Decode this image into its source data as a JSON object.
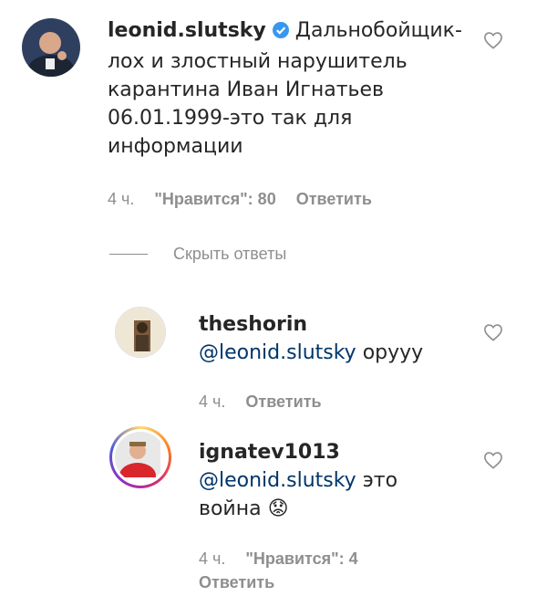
{
  "comments": [
    {
      "username": "leonid.slutsky",
      "verified": true,
      "text_lines": [
        "Дальнобойщик-",
        "лох и злостный нарушитель",
        "карантина Иван Игнатьев",
        "06.01.1999-это так для",
        "информации"
      ],
      "time": "4 ч.",
      "likes": "\"Нравится\": 80",
      "reply": "Ответить"
    }
  ],
  "hide_replies": "Скрыть ответы",
  "replies": [
    {
      "username": "theshorin",
      "mention": "@leonid.slutsky",
      "text": " оруyy",
      "time": "4 ч.",
      "reply": "Ответить"
    },
    {
      "username": "ignatev1013",
      "mention": "@leonid.slutsky",
      "text": " это",
      "text_line2": "война 😟",
      "time": "4 ч.",
      "likes": "\"Нравится\": 4",
      "reply": "Ответить"
    }
  ]
}
